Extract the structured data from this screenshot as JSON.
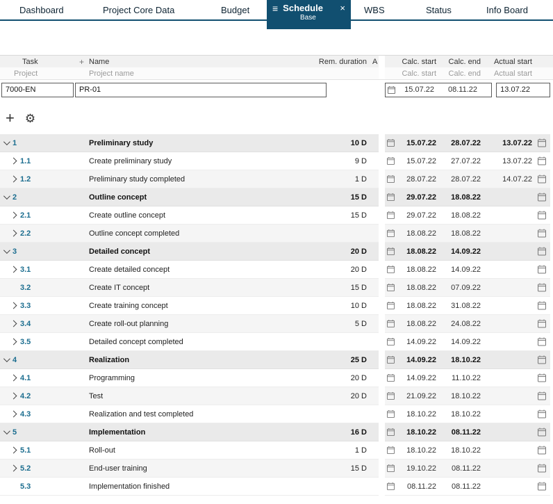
{
  "tabs": {
    "items": [
      {
        "label": "Dashboard",
        "active": false
      },
      {
        "label": "Project Core Data",
        "active": false
      },
      {
        "label": "Budget",
        "active": false
      },
      {
        "label": "Schedule",
        "active": true,
        "sublabel": "Base"
      },
      {
        "label": "WBS",
        "active": false
      },
      {
        "label": "Status",
        "active": false
      },
      {
        "label": "Info Board",
        "active": false
      }
    ]
  },
  "colors": {
    "accent_navy": "#114f70",
    "task_number_blue": "#1b6d8f",
    "parent_row_bg": "#eaeaea",
    "alt_row_bg": "#f5f5f5"
  },
  "table": {
    "columns": {
      "task": "Task",
      "plus": "+",
      "name": "Name",
      "rem_duration": "Rem. duration",
      "a": "A",
      "calc_start": "Calc. start",
      "calc_end": "Calc. end",
      "actual_start": "Actual start"
    },
    "filter_row": {
      "project": "Project",
      "project_name": "Project name",
      "calc_start": "Calc. start",
      "calc_end": "Calc. end",
      "actual_start": "Actual start"
    },
    "project": {
      "id": "7000-EN",
      "name": "PR-01",
      "calc_start": "15.07.22",
      "calc_end": "08.11.22",
      "actual_start": "13.07.22"
    }
  },
  "toolbar": {
    "add_label": "+",
    "settings_icon": "gear"
  },
  "tasks": [
    {
      "number": "1",
      "name": "Preliminary study",
      "duration": "10 D",
      "calc_start": "15.07.22",
      "calc_end": "28.07.22",
      "actual_start": "13.07.22",
      "type": "parent",
      "chevron": "down"
    },
    {
      "number": "1.1",
      "name": "Create preliminary study",
      "duration": "9 D",
      "calc_start": "15.07.22",
      "calc_end": "27.07.22",
      "actual_start": "13.07.22",
      "type": "child",
      "chevron": "right"
    },
    {
      "number": "1.2",
      "name": "Preliminary study completed",
      "duration": "1 D",
      "calc_start": "28.07.22",
      "calc_end": "28.07.22",
      "actual_start": "14.07.22",
      "type": "child",
      "chevron": "right"
    },
    {
      "number": "2",
      "name": "Outline concept",
      "duration": "15 D",
      "calc_start": "29.07.22",
      "calc_end": "18.08.22",
      "actual_start": "",
      "type": "parent",
      "chevron": "down"
    },
    {
      "number": "2.1",
      "name": "Create outline concept",
      "duration": "15 D",
      "calc_start": "29.07.22",
      "calc_end": "18.08.22",
      "actual_start": "",
      "type": "child",
      "chevron": "right"
    },
    {
      "number": "2.2",
      "name": "Outline concept completed",
      "duration": "",
      "calc_start": "18.08.22",
      "calc_end": "18.08.22",
      "actual_start": "",
      "type": "child",
      "chevron": "right"
    },
    {
      "number": "3",
      "name": "Detailed concept",
      "duration": "20 D",
      "calc_start": "18.08.22",
      "calc_end": "14.09.22",
      "actual_start": "",
      "type": "parent",
      "chevron": "down"
    },
    {
      "number": "3.1",
      "name": "Create detailed concept",
      "duration": "20 D",
      "calc_start": "18.08.22",
      "calc_end": "14.09.22",
      "actual_start": "",
      "type": "child",
      "chevron": "right"
    },
    {
      "number": "3.2",
      "name": "Create IT concept",
      "duration": "15 D",
      "calc_start": "18.08.22",
      "calc_end": "07.09.22",
      "actual_start": "",
      "type": "child",
      "chevron": "none"
    },
    {
      "number": "3.3",
      "name": "Create training concept",
      "duration": "10 D",
      "calc_start": "18.08.22",
      "calc_end": "31.08.22",
      "actual_start": "",
      "type": "child",
      "chevron": "right"
    },
    {
      "number": "3.4",
      "name": "Create roll-out planning",
      "duration": "5 D",
      "calc_start": "18.08.22",
      "calc_end": "24.08.22",
      "actual_start": "",
      "type": "child",
      "chevron": "right"
    },
    {
      "number": "3.5",
      "name": "Detailed concept completed",
      "duration": "",
      "calc_start": "14.09.22",
      "calc_end": "14.09.22",
      "actual_start": "",
      "type": "child",
      "chevron": "right"
    },
    {
      "number": "4",
      "name": "Realization",
      "duration": "25 D",
      "calc_start": "14.09.22",
      "calc_end": "18.10.22",
      "actual_start": "",
      "type": "parent",
      "chevron": "down"
    },
    {
      "number": "4.1",
      "name": "Programming",
      "duration": "20 D",
      "calc_start": "14.09.22",
      "calc_end": "11.10.22",
      "actual_start": "",
      "type": "child",
      "chevron": "right"
    },
    {
      "number": "4.2",
      "name": "Test",
      "duration": "20 D",
      "calc_start": "21.09.22",
      "calc_end": "18.10.22",
      "actual_start": "",
      "type": "child",
      "chevron": "right"
    },
    {
      "number": "4.3",
      "name": "Realization and test completed",
      "duration": "",
      "calc_start": "18.10.22",
      "calc_end": "18.10.22",
      "actual_start": "",
      "type": "child",
      "chevron": "right"
    },
    {
      "number": "5",
      "name": "Implementation",
      "duration": "16 D",
      "calc_start": "18.10.22",
      "calc_end": "08.11.22",
      "actual_start": "",
      "type": "parent",
      "chevron": "down"
    },
    {
      "number": "5.1",
      "name": "Roll-out",
      "duration": "1 D",
      "calc_start": "18.10.22",
      "calc_end": "18.10.22",
      "actual_start": "",
      "type": "child",
      "chevron": "right"
    },
    {
      "number": "5.2",
      "name": "End-user training",
      "duration": "15 D",
      "calc_start": "19.10.22",
      "calc_end": "08.11.22",
      "actual_start": "",
      "type": "child",
      "chevron": "right"
    },
    {
      "number": "5.3",
      "name": "Implementation finished",
      "duration": "",
      "calc_start": "08.11.22",
      "calc_end": "08.11.22",
      "actual_start": "",
      "type": "child",
      "chevron": "none"
    }
  ]
}
